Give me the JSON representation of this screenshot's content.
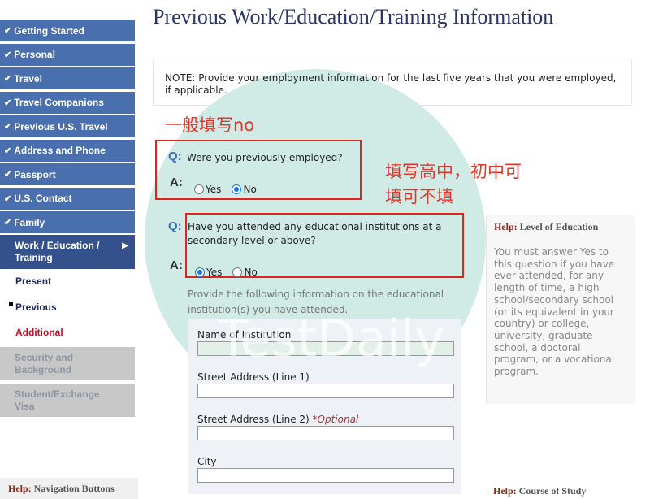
{
  "sidebar": {
    "completed": [
      {
        "label": "Getting Started",
        "icon": "check-icon"
      },
      {
        "label": "Personal",
        "icon": "check-icon"
      },
      {
        "label": "Travel",
        "icon": "check-icon"
      },
      {
        "label": "Travel Companions",
        "icon": "check-icon"
      },
      {
        "label": "Previous U.S. Travel",
        "icon": "check-icon"
      },
      {
        "label": "Address and Phone",
        "icon": "check-icon"
      },
      {
        "label": "Passport",
        "icon": "check-icon"
      },
      {
        "label": "U.S. Contact",
        "icon": "check-icon"
      },
      {
        "label": "Family",
        "icon": "check-icon"
      }
    ],
    "active": {
      "label": "Work / Education / Training",
      "icon": "arrow-right-icon"
    },
    "subitems": [
      {
        "label": "Present",
        "color": "#1f2a5c"
      },
      {
        "label": "Previous",
        "color": "#1f2a5c"
      },
      {
        "label": "Additional",
        "color": "#c8102e"
      }
    ],
    "disabled": [
      {
        "label": "Security and Background"
      },
      {
        "label": "Student/Exchange Visa"
      }
    ],
    "help": {
      "prefix": "Help:",
      "title": "Navigation Buttons"
    }
  },
  "main": {
    "title": "Previous Work/Education/Training Information",
    "note": "NOTE: Provide your employment information for the last five years that you were employed, if applicable.",
    "q_label": "Q:",
    "a_label": "A:",
    "questions": [
      {
        "text": "Were you previously employed?",
        "options": [
          "Yes",
          "No"
        ],
        "selected": "No"
      },
      {
        "text": "Have you attended any educational institutions at a secondary level or above?",
        "options": [
          "Yes",
          "No"
        ],
        "selected": "Yes"
      }
    ],
    "edu_intro": "Provide the following information on the educational institution(s) you have attended.",
    "fields": [
      {
        "label": "Name of Institution",
        "value": ""
      },
      {
        "label": "Street Address (Line 1)",
        "value": ""
      },
      {
        "label": "Street Address (Line 2)",
        "optional": "*Optional",
        "value": ""
      },
      {
        "label": "City",
        "value": ""
      }
    ]
  },
  "help_panel": {
    "prefix": "Help:",
    "title": "Level of Education",
    "body": "You must answer Yes to this question if you have ever attended, for any length of time, a high school/secondary school (or its equivalent in your country) or college, university, graduate school, a doctoral program, or a vocational program.",
    "next_prefix": "Help:",
    "next_title": "Course of Study"
  },
  "annotations": {
    "employed_note": "一般填写no",
    "education_note_1": "填写高中，初中可",
    "education_note_2": "填可不填",
    "color": "#e0231b"
  },
  "watermark": {
    "text": "TestDaily"
  },
  "colors": {
    "nav_bg": "#4a6fae",
    "nav_active": "#35518c",
    "title": "#2a3566",
    "accent_q": "#3f6fb6"
  }
}
